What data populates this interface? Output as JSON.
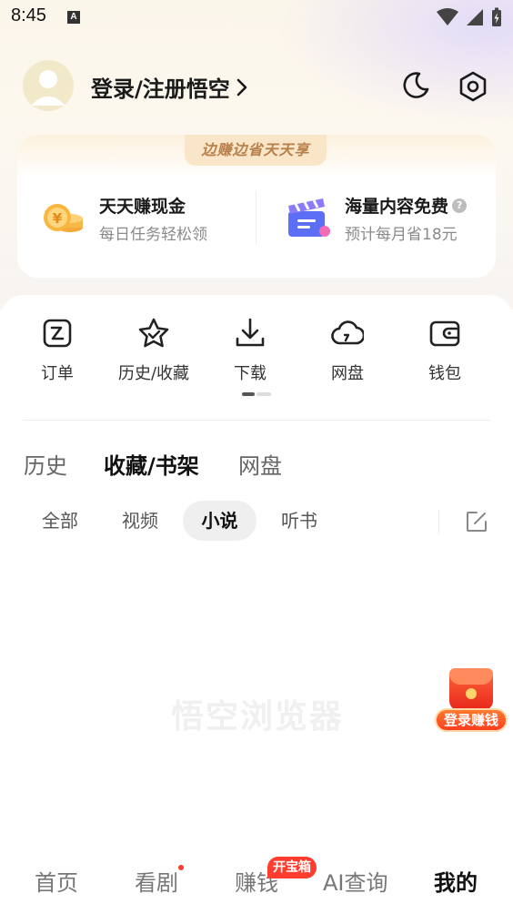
{
  "status_bar": {
    "time": "8:45",
    "a_icon": "A"
  },
  "header": {
    "login_label": "登录/注册悟空"
  },
  "promo": {
    "tab_label": "边赚边省天天享",
    "items": [
      {
        "title": "天天赚现金",
        "subtitle": "每日任务轻松领",
        "icon": "coins-icon"
      },
      {
        "title": "海量内容免费",
        "subtitle": "预计每月省18元",
        "icon": "clapperboard-icon"
      }
    ]
  },
  "quick_actions": [
    {
      "label": "订单",
      "icon": "order-icon"
    },
    {
      "label": "历史/收藏",
      "icon": "star-icon"
    },
    {
      "label": "下载",
      "icon": "download-icon"
    },
    {
      "label": "网盘",
      "icon": "cloud-icon"
    },
    {
      "label": "钱包",
      "icon": "wallet-icon"
    }
  ],
  "tabs": [
    {
      "label": "历史",
      "active": false
    },
    {
      "label": "收藏/书架",
      "active": true
    },
    {
      "label": "网盘",
      "active": false
    }
  ],
  "filters": [
    {
      "label": "全部",
      "active": false
    },
    {
      "label": "视频",
      "active": false
    },
    {
      "label": "小说",
      "active": true
    },
    {
      "label": "听书",
      "active": false
    }
  ],
  "watermark": "悟空浏览器",
  "float_button": {
    "label": "登录赚钱"
  },
  "bottom_nav": {
    "items": [
      {
        "label": "首页",
        "active": false
      },
      {
        "label": "看剧",
        "active": false
      },
      {
        "label": "赚钱",
        "active": false
      },
      {
        "label": "AI查询",
        "active": false
      },
      {
        "label": "我的",
        "active": true
      }
    ],
    "badge": "开宝箱"
  },
  "colors": {
    "accent_red": "#ff3d2e",
    "promo_gold": "#b8804a",
    "text_primary": "#111111",
    "text_secondary": "#8a8a8a"
  }
}
